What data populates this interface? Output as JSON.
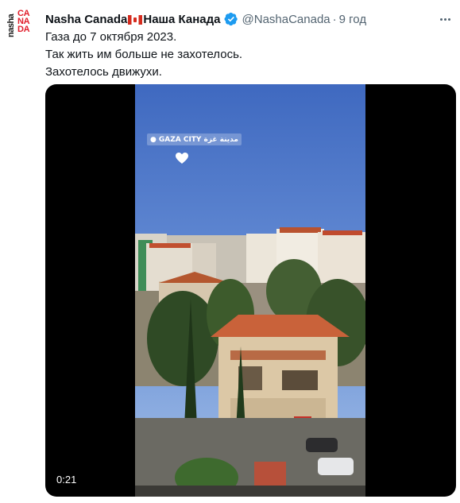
{
  "tweet": {
    "author": {
      "display_name": "Nasha Canada",
      "display_name_suffix": "Наша Канада",
      "handle": "@NashaCanada",
      "separator": "·",
      "time": "9 год",
      "verified": true,
      "avatar": {
        "word_top": "nasha",
        "word_main": "CANADA"
      }
    },
    "text_lines": [
      "Газа до 7 октября 2023.",
      "Так жить им больше не захотелось.",
      "Захотелось движухи."
    ],
    "media": {
      "duration": "0:21",
      "location_sticker": "GAZA CITY",
      "location_sticker_ar": "مدينة غزة",
      "sticker_icon": "heart-icon"
    }
  },
  "colors": {
    "text_primary": "#0f1419",
    "text_secondary": "#536471",
    "verified_blue": "#1d9bf0",
    "brand_red": "#e11d2b"
  }
}
